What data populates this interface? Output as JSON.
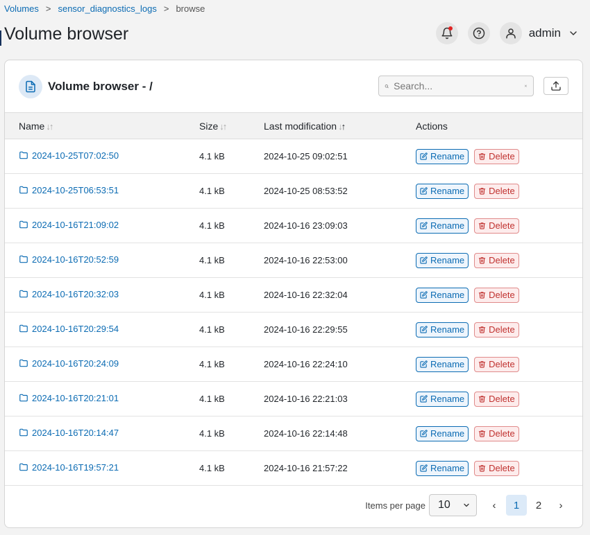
{
  "breadcrumb": {
    "items": [
      "Volumes",
      "sensor_diagnostics_logs"
    ],
    "separator": ">",
    "current": "browse"
  },
  "page": {
    "title": "Volume browser"
  },
  "user": {
    "name": "admin"
  },
  "card": {
    "title": "Volume browser - /",
    "search_placeholder": "Search..."
  },
  "table": {
    "columns": [
      "Name",
      "Size",
      "Last modification",
      "Actions"
    ],
    "rename_label": "Rename",
    "delete_label": "Delete",
    "rows": [
      {
        "name": "2024-10-25T07:02:50",
        "size": "4.1 kB",
        "modified": "2024-10-25 09:02:51"
      },
      {
        "name": "2024-10-25T06:53:51",
        "size": "4.1 kB",
        "modified": "2024-10-25 08:53:52"
      },
      {
        "name": "2024-10-16T21:09:02",
        "size": "4.1 kB",
        "modified": "2024-10-16 23:09:03"
      },
      {
        "name": "2024-10-16T20:52:59",
        "size": "4.1 kB",
        "modified": "2024-10-16 22:53:00"
      },
      {
        "name": "2024-10-16T20:32:03",
        "size": "4.1 kB",
        "modified": "2024-10-16 22:32:04"
      },
      {
        "name": "2024-10-16T20:29:54",
        "size": "4.1 kB",
        "modified": "2024-10-16 22:29:55"
      },
      {
        "name": "2024-10-16T20:24:09",
        "size": "4.1 kB",
        "modified": "2024-10-16 22:24:10"
      },
      {
        "name": "2024-10-16T20:21:01",
        "size": "4.1 kB",
        "modified": "2024-10-16 22:21:03"
      },
      {
        "name": "2024-10-16T20:14:47",
        "size": "4.1 kB",
        "modified": "2024-10-16 22:14:48"
      },
      {
        "name": "2024-10-16T19:57:21",
        "size": "4.1 kB",
        "modified": "2024-10-16 21:57:22"
      }
    ]
  },
  "pagination": {
    "items_per_page_label": "Items per page",
    "items_per_page_value": "10",
    "prev": "‹",
    "next": "›",
    "pages": [
      "1",
      "2"
    ],
    "current_page": "1"
  },
  "colors": {
    "link": "#0b6bb3",
    "danger": "#c0312f",
    "notification": "#e02424"
  }
}
